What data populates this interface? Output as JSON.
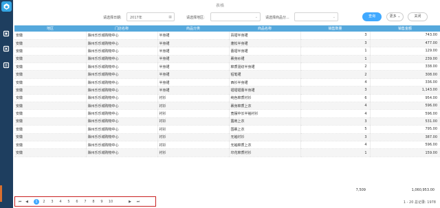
{
  "header": {
    "title": "表格",
    "date_label": "请选择日期:",
    "date_value": "2017年",
    "region_label": "请选择地区:",
    "region_value": "",
    "category_label": "请选择商品分...",
    "category_value": "",
    "query_button": "查询",
    "more_button": "更多",
    "close_button": "关闭"
  },
  "table": {
    "columns": [
      "地区",
      "门店名称",
      "商品分类",
      "商品名称",
      "销售数量",
      "销售金额"
    ],
    "rows": [
      [
        "安徽",
        "滁州乐乐城购物中心",
        "半身裙",
        "百褶半身裙",
        "3",
        "743.00"
      ],
      [
        "安徽",
        "滁州乐乐城购物中心",
        "半身裙",
        "蓬松半身裙",
        "3",
        "477.00"
      ],
      [
        "安徽",
        "滁州乐乐城购物中心",
        "半身裙",
        "蕾褶半身裙",
        "1",
        "129.00"
      ],
      [
        "安徽",
        "滁州乐乐城购物中心",
        "半身裙",
        "裹身纱裙",
        "1",
        "239.00"
      ],
      [
        "安徽",
        "滁州乐乐城购物中心",
        "半身裙",
        "棉质混纺半身裙",
        "2",
        "338.00"
      ],
      [
        "安徽",
        "滁州乐乐城购物中心",
        "半身裙",
        "铅笔裙",
        "2",
        "308.00"
      ],
      [
        "安徽",
        "滁州乐乐城购物中心",
        "半身裙",
        "西衫半身裙",
        "4",
        "336.00"
      ],
      [
        "安徽",
        "滁州乐乐城购物中心",
        "半身裙",
        "褶褶褶蕾半身裙",
        "3",
        "1,143.00"
      ],
      [
        "安徽",
        "滁州乐乐城购物中心",
        "衬衫",
        "纯色棉质衬衫",
        "6",
        "954.00"
      ],
      [
        "安徽",
        "滁州乐乐城购物中心",
        "衬衫",
        "裹身棉质上衣",
        "4",
        "596.00"
      ],
      [
        "安徽",
        "滁州乐乐城购物中心",
        "衬衫",
        "宽摆中长半袖衬衫",
        "4",
        "596.00"
      ],
      [
        "安徽",
        "滁州乐乐城购物中心",
        "衬衫",
        "露肩上衣",
        "3",
        "531.00"
      ],
      [
        "安徽",
        "滁州乐乐城购物中心",
        "衬衫",
        "围裹上衣",
        "5",
        "795.00"
      ],
      [
        "安徽",
        "滁州乐乐城购物中心",
        "衬衫",
        "无袖衬衫",
        "3",
        "387.00"
      ],
      [
        "安徽",
        "滁州乐乐城购物中心",
        "衬衫",
        "无袖棉质上衣",
        "4",
        "596.00"
      ],
      [
        "安徽",
        "滁州乐乐城购物中心",
        "衬衫",
        "印花棉质衬衫",
        "1",
        "159.00"
      ]
    ],
    "total_qty": "7,509",
    "total_amount": "1,060,953.00"
  },
  "pager": {
    "first": "⏮",
    "prev": "◀",
    "pages": [
      "1",
      "2",
      "3",
      "4",
      "5",
      "6",
      "7",
      "8",
      "9",
      "10"
    ],
    "current_page": 1,
    "next": "▶",
    "last": "⏭",
    "summary": "1 - 20 总记录: 1978"
  },
  "colors": {
    "sidebar": "#1e3e5f",
    "header_row": "#55a8dc",
    "accent": "#40a9ff",
    "highlight_border": "#c81e1e"
  },
  "icons": [
    "app-logo-icon",
    "home-icon",
    "report-icon",
    "edit-icon",
    "calendar-icon"
  ]
}
